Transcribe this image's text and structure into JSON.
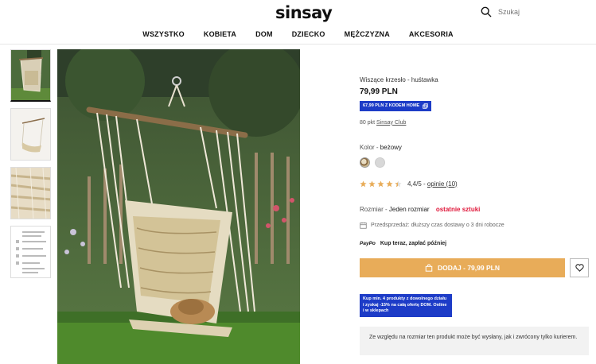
{
  "brand": {
    "logo": "sinsay"
  },
  "search": {
    "placeholder": "Szukaj"
  },
  "nav": {
    "items": [
      "WSZYSTKO",
      "KOBIETA",
      "DOM",
      "DZIECKO",
      "MĘŻCZYZNA",
      "AKCESORIA"
    ]
  },
  "product": {
    "name": "Wiszące krzesło - huśtawka",
    "price": "79,99 PLN",
    "promo_code": "67,99 PLN Z KODEM HOME",
    "club_points": "80 pkt",
    "club_link": "Sinsay Club",
    "color_label": "Kolor -",
    "color_value": "beżowy",
    "rating_value": "4,4/5 -",
    "reviews_link": "opinie (10)",
    "size_label": "Rozmiar -",
    "size_value": "Jeden rozmiar",
    "stock_status": "ostatnie sztuki",
    "presale_text": "Przedsprzedaż: dłuższy czas dostawy o 3 dni robocze",
    "paypo_logo": "PayPo",
    "paypo_text": "Kup teraz, zapłać później",
    "add_button": "DODAJ - 79,99 PLN",
    "banner_text": "Kup min. 4 produkty z dowolnego działu i zyskaj -15% na całą ofertę DOM. Online i w sklepach",
    "notice_text": "Ze względu na rozmiar ten produkt może być wysłany, jak i zwrócony tylko kurierem."
  },
  "rating": {
    "stars": 4.4,
    "max": 5
  },
  "colors": {
    "accent": "#e8ac59",
    "promo_blue": "#1d3cc7",
    "stock_red": "#e0173a"
  }
}
